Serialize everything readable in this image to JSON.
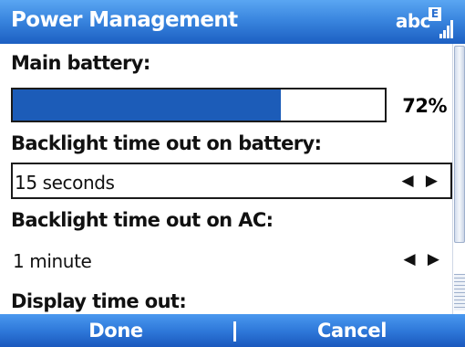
{
  "title": "Power Management",
  "input_indicator": {
    "text": "abc",
    "mode_letter": "E",
    "icon": "signal-strength-icon"
  },
  "sections": {
    "main_battery": {
      "label": "Main battery:",
      "percent_text": "72%",
      "fill_fraction": 0.72
    },
    "backlight_battery": {
      "label": "Backlight time out on battery:",
      "value": "15 seconds",
      "arrows": "◀ ▶"
    },
    "backlight_ac": {
      "label": "Backlight time out on AC:",
      "value": "1 minute",
      "arrows": "◀ ▶"
    },
    "display_timeout": {
      "label": "Display time out:"
    }
  },
  "softkeys": {
    "left": "Done",
    "right": "Cancel"
  },
  "colors": {
    "title_bar": "#2a75d6",
    "battery_fill": "#1c5cb8",
    "softkey_bar": "#2f79da"
  }
}
